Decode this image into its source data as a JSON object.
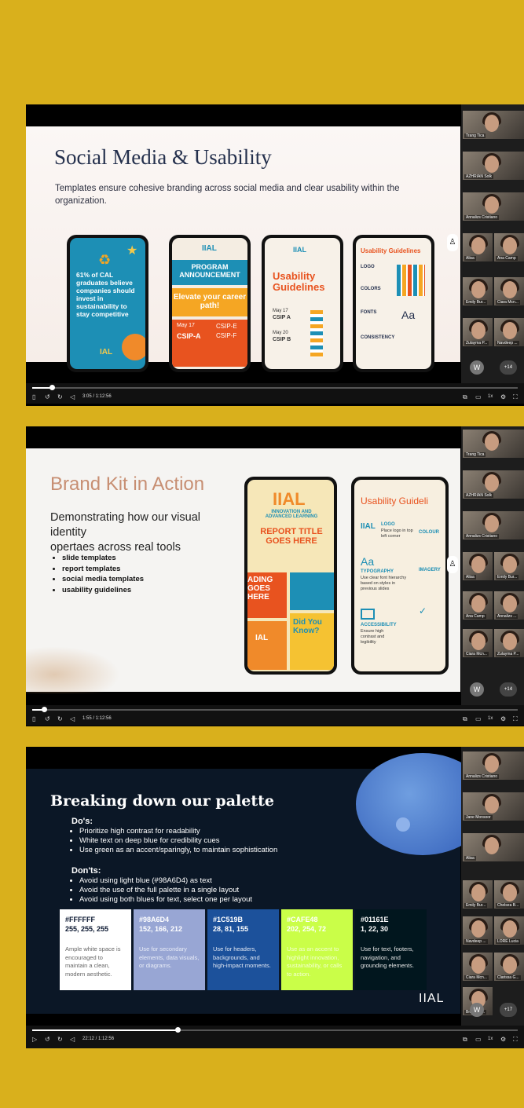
{
  "slide1": {
    "title": "Social Media & Usability",
    "subtitle": "Templates ensure cohesive branding across social media and clear usability within the organization.",
    "phone1": {
      "stat": "61% of CAL graduates believe companies should invest in sustainability to stay competitive",
      "brand": "IAL"
    },
    "phone2": {
      "logo": "IIAL",
      "heading": "PROGRAM ANNOUNCEMENT",
      "tagline": "Elevate your career path!",
      "date": "May 17",
      "c1": "CSIP-A",
      "c2": "CSIP-E",
      "c3": "CSIP-F"
    },
    "phone3": {
      "logo": "IIAL",
      "title": "Usability Guidelines",
      "d1": "May 17",
      "t1": "CSIP A",
      "d2": "May 20",
      "t2": "CSIP B"
    },
    "phone4": {
      "title": "Usability Guidelines",
      "logo": "LOGO",
      "colors": "COLORS",
      "fonts": "FONTS",
      "consistency": "CONSISTENCY",
      "aa": "Aa"
    },
    "time": "3:05 / 1:12:56",
    "progress": 0.04
  },
  "slide2": {
    "title": "Brand Kit in Action",
    "body1": "Demonstrating how our visual identity",
    "body2": "opertaes across real tools",
    "bullets": [
      "slide templates",
      "report templates",
      "social media templates",
      "usability guidelines"
    ],
    "phoneA": {
      "logo": "IIAL",
      "sub": "INNOVATION AND ADVANCED LEARNING",
      "report": "REPORT TITLE GOES HERE",
      "heading": "ADING GOES HERE",
      "ial": "IAL",
      "didyou": "Did You Know?"
    },
    "phoneB": {
      "title": "Usability Guideli",
      "logo_label": "LOGO",
      "logo_text": "Place logo in top left corner",
      "colour": "COLOUR",
      "aa": "Aa",
      "typo": "TYPOGRAPHY",
      "typo_text": "Use clear font hierarchy based on styles in previous slides",
      "imagery": "IMAGERY",
      "access": "ACCESSIBILITY",
      "access_text": "Ensure high contrast and legibility",
      "iial": "IIAL"
    },
    "time": "1:55 / 1:12:56",
    "progress": 0.025
  },
  "slide3": {
    "title": "Breaking down our palette",
    "dos_label": "Do's:",
    "dos": [
      "Prioritize high contrast for readability",
      "White text on deep blue for credibility cues",
      "Use green as an accent/sparingly, to maintain sophistication"
    ],
    "donts_label": "Don'ts:",
    "donts": [
      "Avoid using light blue (#98A6D4) as text",
      "Avoid the use of the full palette in a single layout",
      "Avoid using both blues for text, select one per layout"
    ],
    "swatches": [
      {
        "hex": "#FFFFFF",
        "rgb": "255, 255, 255",
        "desc": "Ample white space is encouraged to maintain a clean, modern aesthetic.",
        "bg": "#FFFFFF",
        "fg": "#0a1730",
        "dfg": "#666666"
      },
      {
        "hex": "#98A6D4",
        "rgb": "152, 166, 212",
        "desc": "Use for secondary elements, data visuals, or diagrams.",
        "bg": "#98A6D4",
        "fg": "#ffffff",
        "dfg": "#e8ecf7"
      },
      {
        "hex": "#1C519B",
        "rgb": "28, 81, 155",
        "desc": "Use for headers, backgrounds, and high-impact moments.",
        "bg": "#1C519B",
        "fg": "#ffffff",
        "dfg": "#e2e8f3"
      },
      {
        "hex": "#CAFE48",
        "rgb": "202, 254, 72",
        "desc": "Use as an accent to highlight innovation, sustainability, or calls to action.",
        "bg": "#CAFE48",
        "fg": "#ffffff",
        "dfg": "#f4ffd4"
      },
      {
        "hex": "#01161E",
        "rgb": "1, 22, 30",
        "desc": "Use for text, footers, navigation, and grounding elements.",
        "bg": "#01161E",
        "fg": "#ffffff",
        "dfg": "#e6e6e6"
      }
    ],
    "logo": "IIAL",
    "time": "22:12 / 1:12:56",
    "progress": 0.3
  },
  "participants1": [
    "Trang Tica",
    "AZHRIAN Solk",
    "Annalizs Cristiano",
    "Alisa",
    "Ana Camp",
    "Emily Bur...",
    "Ciara Mcn...",
    "Zulayma P...",
    "Navdeep ..."
  ],
  "participants2": [
    "Trang Tica",
    "AZHRIAN Solk",
    "Annalizs Cristiano",
    "Alisa",
    "Emily Bur...",
    "Ana Camp",
    "Annalizs ...",
    "Ciara Mcn...",
    "Zulayma P...",
    "Navdeep ..."
  ],
  "participants3": [
    "Annalizs Cristiano",
    "Jane Monsoor",
    "Alisa",
    "Emily Bur...",
    "Chelsea B...",
    "Navdeep ...",
    "LORE Lucia",
    "Ciara Mcn...",
    "Clarissa G...",
    "Brandy L..."
  ],
  "w_avatar": "W",
  "more1": "+14",
  "more2": "+14",
  "more3": "+17",
  "speed": "1x"
}
